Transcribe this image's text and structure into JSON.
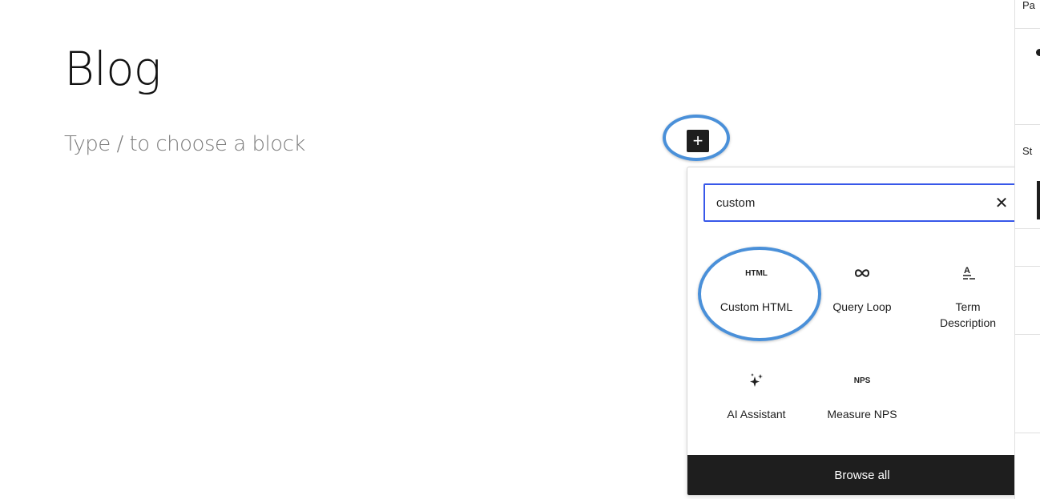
{
  "editor": {
    "title": "Blog",
    "placeholder": "Type / to choose a block",
    "inserter_toggle_glyph": "+"
  },
  "inserter": {
    "search": {
      "value": "custom",
      "clear_glyph": "✕"
    },
    "blocks": [
      {
        "label": "Custom HTML",
        "icon": "html-icon",
        "icon_text": "HTML"
      },
      {
        "label": "Query Loop",
        "icon": "loop-icon",
        "icon_text": ""
      },
      {
        "label": "Term Description",
        "icon": "term-description-icon",
        "icon_text": ""
      },
      {
        "label": "AI Assistant",
        "icon": "sparkles-icon",
        "icon_text": ""
      },
      {
        "label": "Measure NPS",
        "icon": "nps-icon",
        "icon_text": "NPS"
      }
    ],
    "browse_all_label": "Browse all"
  },
  "sidebar": {
    "tab_partial": "Pa",
    "section_partial": "St"
  },
  "colors": {
    "accent": "#3858e9",
    "highlight": "#4a90d9",
    "dark": "#1e1e1e"
  }
}
